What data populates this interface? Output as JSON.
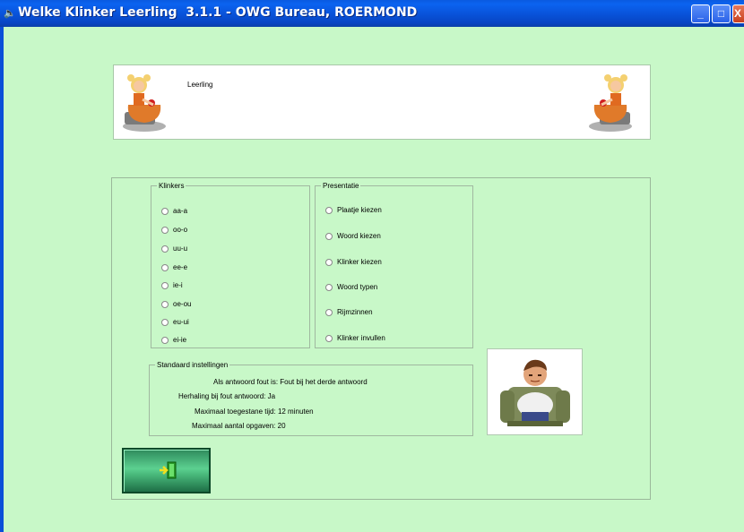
{
  "window": {
    "title": "Welke Klinker Leerling  3.1.1 - OWG Bureau, ROERMOND",
    "app_icon": "speaker-icon",
    "min_glyph": "_",
    "max_glyph": "□",
    "close_glyph": "X"
  },
  "header": {
    "label": "Leerling",
    "left_figure": "girl-at-desk-icon",
    "right_figure": "girl-at-desk-icon"
  },
  "klinkers": {
    "legend": "Klinkers",
    "options": [
      "aa-a",
      "oo-o",
      "uu-u",
      "ee-e",
      "ie-i",
      "oe-ou",
      "eu-ui",
      "ei-ie"
    ]
  },
  "presentatie": {
    "legend": "Presentatie",
    "options": [
      "Plaatje kiezen",
      "Woord kiezen",
      "Klinker kiezen",
      "Woord typen",
      "Rijmzinnen",
      "Klinker invullen"
    ]
  },
  "standaard": {
    "legend": "Standaard instellingen",
    "lines": [
      "Als antwoord fout is: Fout bij het derde antwoord",
      "Herhaling bij fout antwoord: Ja",
      "Maximaal toegestane tijd: 12 minuten",
      "Maximaal aantal opgaven: 20"
    ]
  },
  "avatar": {
    "icon": "boy-in-armchair-icon"
  },
  "exit_button": {
    "icon": "exit-door-icon"
  }
}
